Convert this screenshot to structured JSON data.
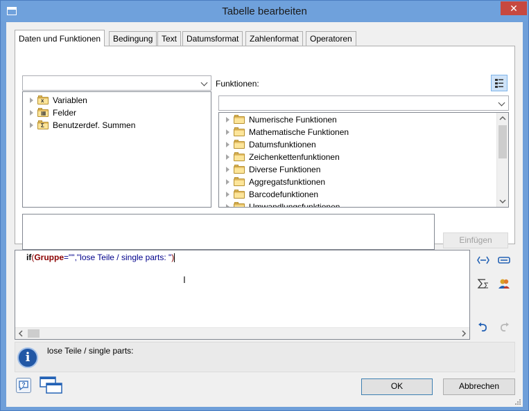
{
  "window": {
    "title": "Tabelle bearbeiten",
    "close_glyph": "✕"
  },
  "tabs": [
    {
      "label": "Daten und Funktionen",
      "active": true
    },
    {
      "label": "Bedingung",
      "active": false
    },
    {
      "label": "Text",
      "active": false
    },
    {
      "label": "Datumsformat",
      "active": false
    },
    {
      "label": "Zahlenformat",
      "active": false
    },
    {
      "label": "Operatoren",
      "active": false
    }
  ],
  "left_panel": {
    "combo_value": "",
    "tree": [
      {
        "label": "Variablen",
        "icon": "variables-folder-icon",
        "mark": "x"
      },
      {
        "label": "Felder",
        "icon": "fields-folder-icon",
        "mark": "▦"
      },
      {
        "label": "Benutzerdef. Summen",
        "icon": "sums-folder-icon",
        "mark": "Σ"
      }
    ]
  },
  "right_panel": {
    "label": "Funktionen:",
    "combo_value": "",
    "tree": [
      {
        "label": "Numerische Funktionen"
      },
      {
        "label": "Mathematische Funktionen"
      },
      {
        "label": "Datumsfunktionen"
      },
      {
        "label": "Zeichenkettenfunktionen"
      },
      {
        "label": "Diverse Funktionen"
      },
      {
        "label": "Aggregatsfunktionen"
      },
      {
        "label": "Barcodefunktionen"
      },
      {
        "label": "Umwandlungsfunktionen"
      }
    ]
  },
  "description": {
    "text": ""
  },
  "buttons": {
    "insert": "Einfügen",
    "ok": "OK",
    "cancel": "Abbrechen"
  },
  "editor": {
    "kw_if": "if",
    "open": "(",
    "field": "Gruppe",
    "eq": "=",
    "empty_str": "\"\"",
    "comma": ",",
    "str2": "\"lose Teile / single parts: \"",
    "close": ")"
  },
  "info": {
    "text": "lose Teile / single parts:"
  },
  "colors": {
    "keyword": "#000000",
    "field": "#8b0000",
    "string": "#00008b",
    "titlebar": "#6fa1dc",
    "close": "#c7483f"
  }
}
